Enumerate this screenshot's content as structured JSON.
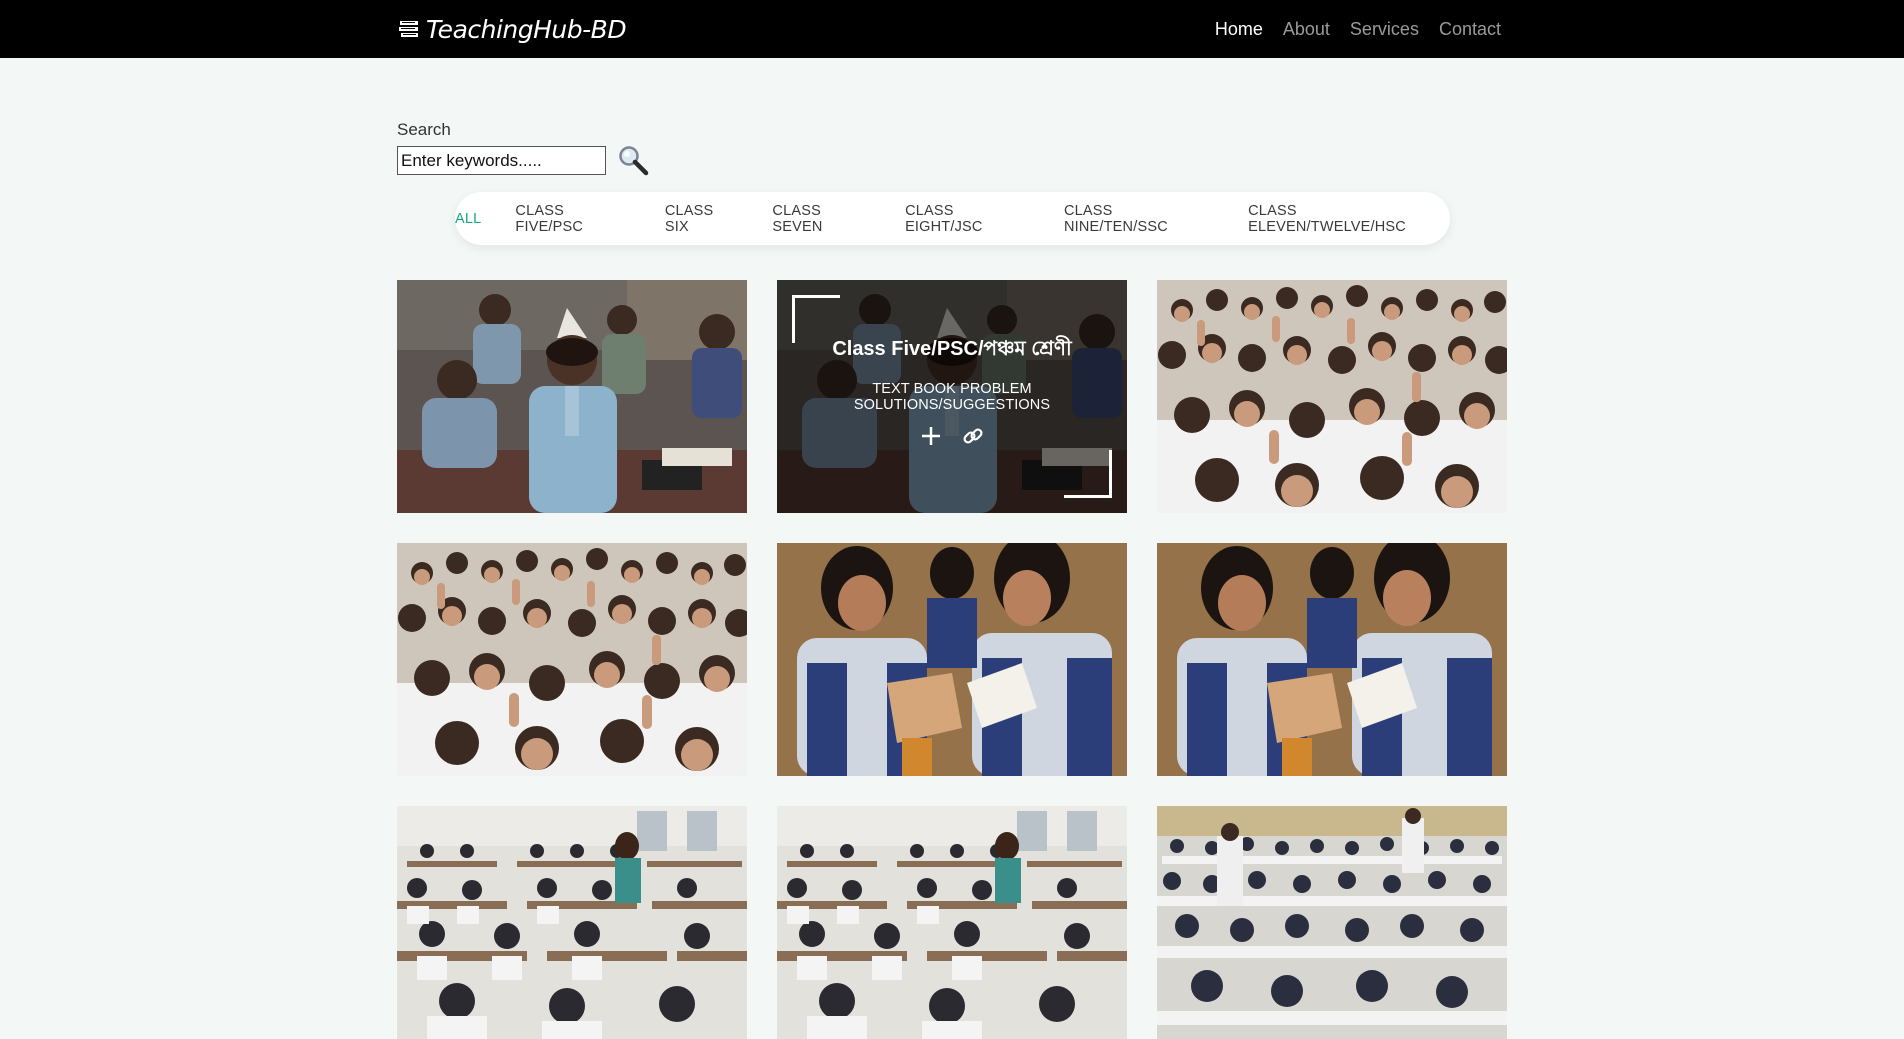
{
  "navbar": {
    "brand": "TeachingHub-BD",
    "links": [
      {
        "label": "Home",
        "active": true
      },
      {
        "label": "About",
        "active": false
      },
      {
        "label": "Services",
        "active": false
      },
      {
        "label": "Contact",
        "active": false
      }
    ]
  },
  "search": {
    "label": "Search",
    "placeholder": "Enter keywords.....",
    "button_icon": "magnifier-icon"
  },
  "filters": [
    {
      "label": "ALL",
      "active": true
    },
    {
      "label": "CLASS FIVE/PSC",
      "active": false
    },
    {
      "label": "CLASS SIX",
      "active": false
    },
    {
      "label": "CLASS SEVEN",
      "active": false
    },
    {
      "label": "CLASS EIGHT/JSC",
      "active": false
    },
    {
      "label": "CLASS NINE/TEN/SSC",
      "active": false
    },
    {
      "label": "CLASS ELEVEN/TWELVE/HSC",
      "active": false
    }
  ],
  "gallery": {
    "hover_card": {
      "title": "Class Five/PSC/পঞ্চম শ্রেণী",
      "subtitle": "TEXT BOOK PROBLEM SOLUTIONS/SUGGESTIONS",
      "icons": [
        "plus-icon",
        "link-icon"
      ]
    },
    "items": [
      {
        "scene": "classroom-boy"
      },
      {
        "scene": "classroom-boy",
        "hover": true
      },
      {
        "scene": "cheering-students"
      },
      {
        "scene": "cheering-students"
      },
      {
        "scene": "girls-reading"
      },
      {
        "scene": "girls-reading"
      },
      {
        "scene": "exam-hall"
      },
      {
        "scene": "exam-hall"
      },
      {
        "scene": "exam-hall-crowded"
      }
    ]
  },
  "colors": {
    "navbar_bg": "#000000",
    "page_bg": "#f3f8f7",
    "filter_active": "#1aa786",
    "nav_active": "#ffffff",
    "nav_inactive": "#9a9a9a"
  }
}
